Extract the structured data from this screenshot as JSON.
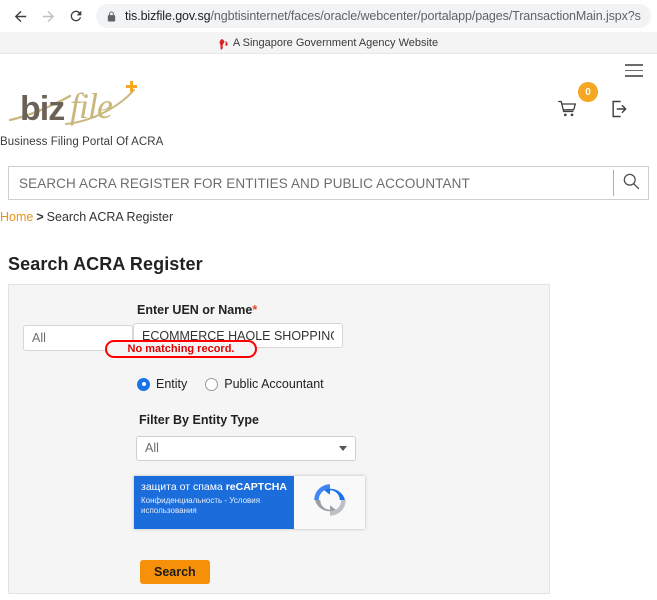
{
  "browser": {
    "back_icon": "arrow-left-icon",
    "forward_icon": "arrow-right-icon",
    "reload_icon": "reload-icon",
    "lock_icon": "lock-icon",
    "url_host": "tis.bizfile.gov.sg",
    "url_path": "/ngbtisinternet/faces/oracle/webcenter/portalapp/pages/TransactionMain.jspx?selecte"
  },
  "gov_banner": {
    "text": "A Singapore Government Agency Website",
    "icon": "singapore-flag-icon"
  },
  "site_header": {
    "logo_biz": "biz",
    "logo_file": "file",
    "logo_plus": "+",
    "tagline": "Business Filing Portal Of ACRA",
    "cart_icon": "cart-icon",
    "cart_count": "0",
    "login_icon": "login-icon",
    "menu_icon": "hamburger-menu-icon",
    "accent_color": "#f5a623"
  },
  "search": {
    "placeholder": "SEARCH ACRA REGISTER FOR ENTITIES AND PUBLIC ACCOUNTANT",
    "value": "",
    "icon": "magnifier-icon"
  },
  "breadcrumb": {
    "home": "Home",
    "separator": ">",
    "current": "Search ACRA Register"
  },
  "main": {
    "page_title": "Search ACRA Register",
    "uen_label": "Enter UEN or Name",
    "uen_required_mark": "*",
    "scope_select_value": "All",
    "uen_value": "ECOMMERCE HAOLE SHOPPING",
    "error_message": "No matching record.",
    "error_color": "#e00000",
    "radio_entity": "Entity",
    "radio_public_accountant": "Public Accountant",
    "selected_radio": "Entity",
    "filter_label": "Filter By Entity Type",
    "filter_value": "All",
    "recaptcha_title_plain": "защита от спама ",
    "recaptcha_title_brand": "reCAPTCHA",
    "recaptcha_sub": "Конфиденциальность - Условия использования",
    "recaptcha_icon": "recaptcha-logo-icon",
    "search_button": "Search",
    "search_button_color": "#f79009"
  }
}
